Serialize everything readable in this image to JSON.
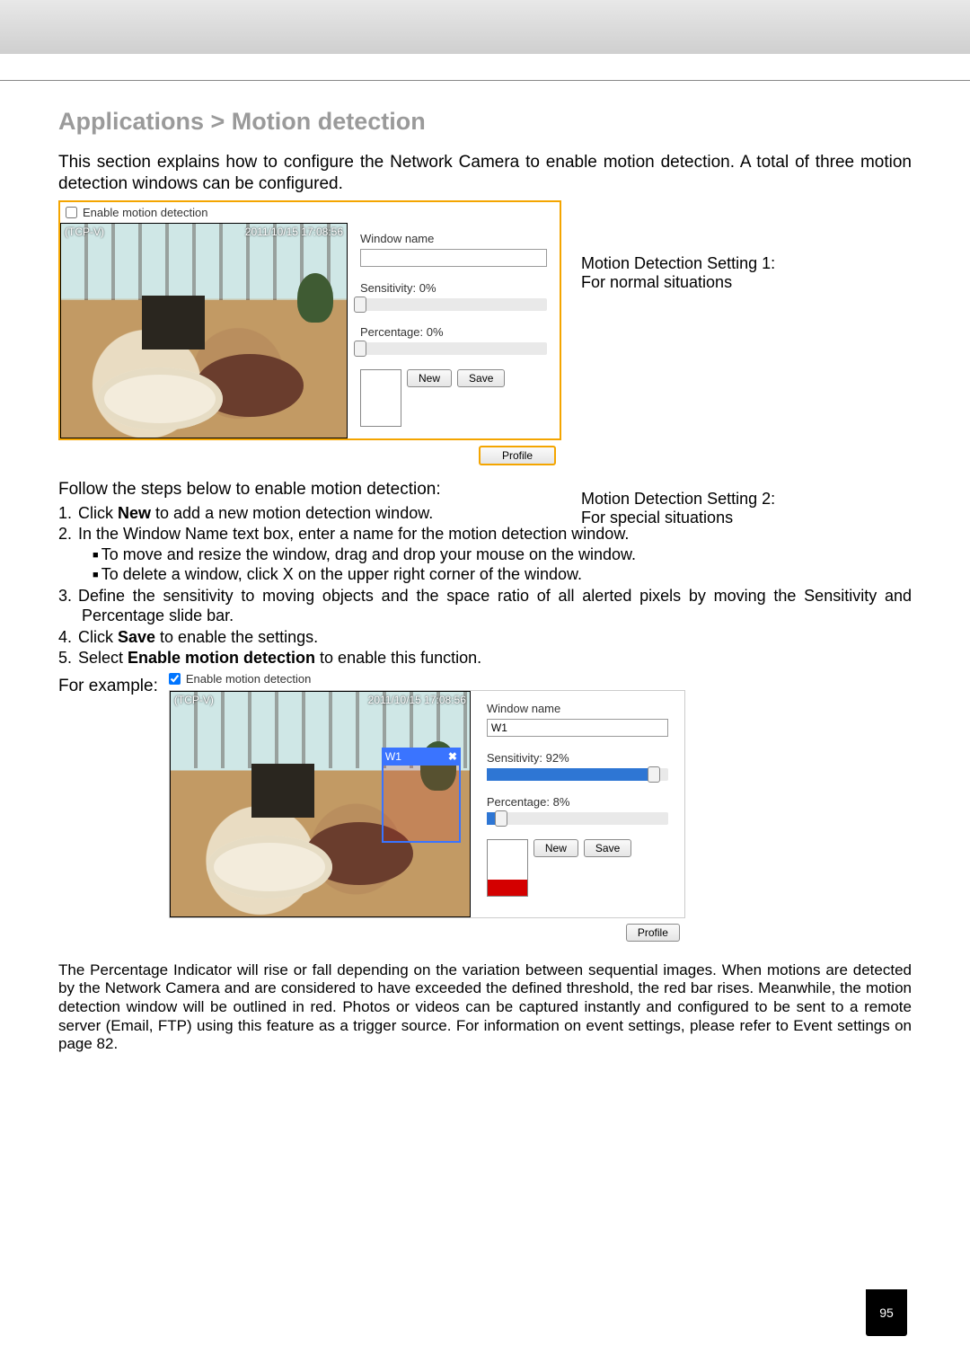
{
  "title": "Applications > Motion detection",
  "intro": "This section explains how to configure the Network Camera to enable motion detection. A total of three motion detection windows can be configured.",
  "caption1_line1": "Motion Detection Setting 1:",
  "caption1_line2": "For normal situations",
  "caption2_line1": "Motion Detection Setting 2:",
  "caption2_line2": "For special situations",
  "panel": {
    "enable_label": "Enable motion detection",
    "osd_left": "(TCP-V)",
    "osd_right": "2011/10/15 17:08:56",
    "window_name_label": "Window name",
    "sensitivity_label_0": "Sensitivity: 0%",
    "percentage_label_0": "Percentage: 0%",
    "sensitivity_label_ex": "Sensitivity: 92%",
    "percentage_label_ex": "Percentage: 8%",
    "new_btn": "New",
    "save_btn": "Save",
    "profile_btn": "Profile",
    "w1_name": "W1"
  },
  "steps_intro": "Follow the steps below to enable motion detection:",
  "steps": {
    "s1a": "Click ",
    "s1b": "New",
    "s1c": " to add a new motion detection window.",
    "s2": "In the Window Name text box, enter a name for the motion detection window.",
    "s2a": "To move and resize the window, drag and drop your mouse on the window.",
    "s2b": "To delete a window, click X on the upper right corner of the window.",
    "s3": "Define the sensitivity to moving objects and the space ratio of all alerted pixels by moving the Sensitivity and Percentage slide bar.",
    "s4a": "Click ",
    "s4b": "Save",
    "s4c": " to enable the settings.",
    "s5a": "Select ",
    "s5b": "Enable motion detection",
    "s5c": " to enable this function."
  },
  "for_example": "For example:",
  "bottom": "The Percentage Indicator will rise or fall depending on the variation between sequential images. When motions are detected by the Network Camera and are considered to have exceeded the defined threshold, the red bar rises. Meanwhile, the motion detection window will be outlined in red. Photos or videos can be captured instantly and configured to be sent to a remote server (Email, FTP) using this feature as a trigger source. For information on event settings, please refer to Event settings on page 82.",
  "page_number": "95"
}
